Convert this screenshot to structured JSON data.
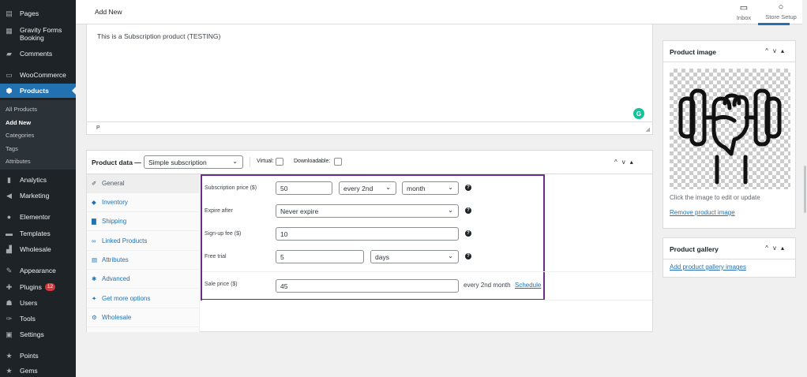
{
  "sidebar": {
    "items": [
      {
        "icon": "pages-icon",
        "label": "Pages"
      },
      {
        "icon": "calendar-icon",
        "label": "Gravity Forms Booking"
      },
      {
        "icon": "comments-icon",
        "label": "Comments"
      },
      {
        "icon": "woocommerce-icon",
        "label": "WooCommerce"
      },
      {
        "icon": "products-icon",
        "label": "Products"
      },
      {
        "icon": "analytics-icon",
        "label": "Analytics"
      },
      {
        "icon": "marketing-icon",
        "label": "Marketing"
      },
      {
        "icon": "elementor-icon",
        "label": "Elementor"
      },
      {
        "icon": "templates-icon",
        "label": "Templates"
      },
      {
        "icon": "wholesale-icon",
        "label": "Wholesale"
      },
      {
        "icon": "appearance-icon",
        "label": "Appearance"
      },
      {
        "icon": "plugins-icon",
        "label": "Plugins",
        "badge": "12"
      },
      {
        "icon": "users-icon",
        "label": "Users"
      },
      {
        "icon": "tools-icon",
        "label": "Tools"
      },
      {
        "icon": "settings-icon",
        "label": "Settings"
      },
      {
        "icon": "star-icon",
        "label": "Points"
      },
      {
        "icon": "star-icon",
        "label": "Gems"
      }
    ],
    "submenu": [
      "All Products",
      "Add New",
      "Categories",
      "Tags",
      "Attributes"
    ]
  },
  "header": {
    "title": "Add New",
    "actions": [
      {
        "icon": "inbox-icon",
        "label": "Inbox"
      },
      {
        "icon": "circle-icon",
        "label": "Store Setup"
      }
    ]
  },
  "editor": {
    "content": "This is a Subscription product (TESTING)",
    "path": "P",
    "grammarly": "G"
  },
  "product_data": {
    "title": "Product data —",
    "type_selected": "Simple subscription",
    "virtual_label": "Virtual:",
    "downloadable_label": "Downloadable:",
    "tabs": [
      {
        "icon": "wrench-icon",
        "label": "General"
      },
      {
        "icon": "inventory-icon",
        "label": "Inventory"
      },
      {
        "icon": "truck-icon",
        "label": "Shipping"
      },
      {
        "icon": "link-icon",
        "label": "Linked Products"
      },
      {
        "icon": "table-icon",
        "label": "Attributes"
      },
      {
        "icon": "gear-icon",
        "label": "Advanced"
      },
      {
        "icon": "plug-icon",
        "label": "Get more options"
      },
      {
        "icon": "wholesale-icon",
        "label": "Wholesale"
      }
    ],
    "fields": {
      "subscription_price": {
        "label": "Subscription price ($)",
        "value": "50",
        "interval": "every 2nd",
        "period": "month"
      },
      "expire_after": {
        "label": "Expire after",
        "value": "Never expire"
      },
      "signup_fee": {
        "label": "Sign-up fee ($)",
        "value": "10"
      },
      "free_trial": {
        "label": "Free trial",
        "value": "5",
        "period": "days"
      },
      "sale_price": {
        "label": "Sale price ($)",
        "value": "45",
        "suffix": "every 2nd month",
        "schedule": "Schedule"
      }
    },
    "help_glyph": "?"
  },
  "product_image": {
    "title": "Product image",
    "hint": "Click the image to edit or update",
    "remove_link": "Remove product image"
  },
  "product_gallery": {
    "title": "Product gallery",
    "add_link": "Add product gallery images"
  },
  "colors": {
    "sidebar_bg": "#1d2327",
    "accent": "#2271b1",
    "highlight": "#6b2d8c",
    "grammarly": "#15c39a"
  }
}
